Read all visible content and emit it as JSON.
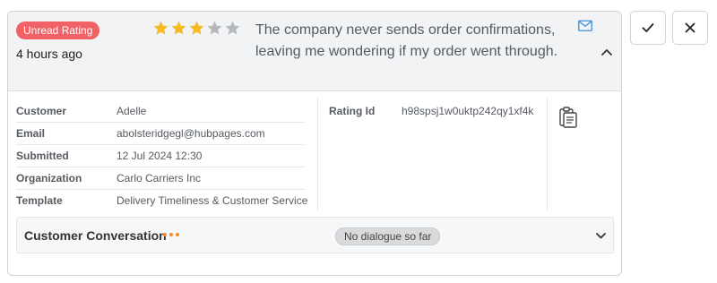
{
  "header": {
    "badge": "Unread Rating",
    "time_ago": "4 hours ago",
    "rating": {
      "filled": 3,
      "max": 5
    },
    "review_text": "The company never sends order confirmations, leaving me wondering if my order went through."
  },
  "details": {
    "rows": [
      {
        "label": "Customer",
        "value": "Adelle"
      },
      {
        "label": "Email",
        "value": "abolsteridgegl@hubpages.com"
      },
      {
        "label": "Submitted",
        "value": "12 Jul 2024 12:30"
      },
      {
        "label": "Organization",
        "value": "Carlo Carriers Inc"
      },
      {
        "label": "Template",
        "value": "Delivery Timeliness & Customer Service"
      }
    ],
    "rating_id_label": "Rating Id",
    "rating_id_value": "h98spsj1w0uktp242qy1xf4k"
  },
  "conversation": {
    "title": "Customer Conversation",
    "status": "No dialogue so far"
  },
  "icons": {
    "mail": "mail-icon",
    "collapse": "chevron-up-icon",
    "clipboard": "clipboard-icon",
    "expand": "chevron-down-icon",
    "approve": "check-icon",
    "dismiss": "close-icon"
  },
  "colors": {
    "badge_bg": "#f06266",
    "star_filled": "#f5b921",
    "star_empty": "#b5b8bb",
    "accent_blue": "#3d8fd6",
    "dots_orange": "#f08a2b"
  }
}
